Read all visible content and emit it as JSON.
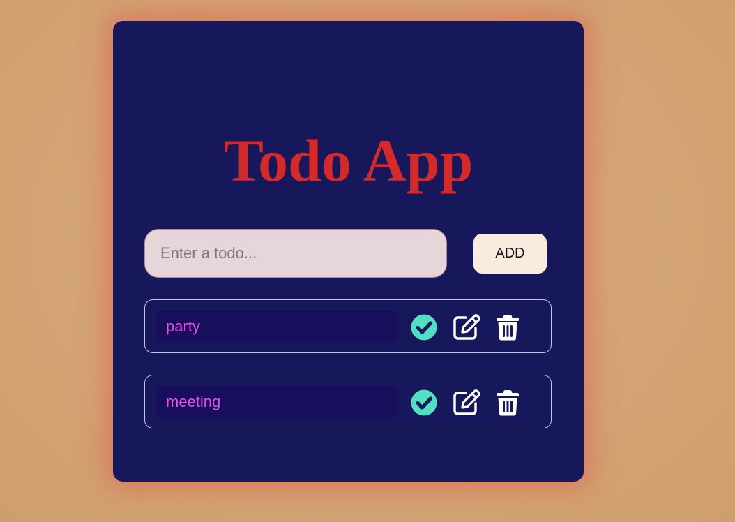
{
  "app": {
    "title": "Todo App"
  },
  "form": {
    "placeholder": "Enter a todo...",
    "value": "",
    "add_label": "ADD"
  },
  "todos": [
    {
      "text": "party"
    },
    {
      "text": "meeting"
    }
  ],
  "icons": {
    "complete": "check-circle-icon",
    "edit": "pen-to-square-icon",
    "delete": "trash-can-icon"
  },
  "colors": {
    "background": "#d5a678",
    "card": "#17185b",
    "title": "#d42a29",
    "input_bg": "#e6d6d9",
    "add_button_bg": "#f9ebdd",
    "todo_text": "#e54ee7",
    "todo_text_bg": "#170f5c",
    "check": "#4ee0c0",
    "icon_light": "#ffffff"
  }
}
